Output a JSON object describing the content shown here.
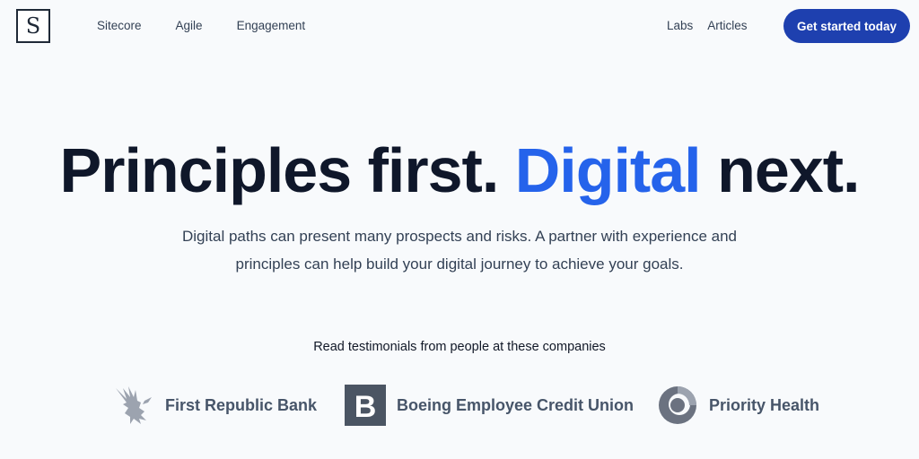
{
  "header": {
    "logo_letter": "S",
    "nav_left": [
      "Sitecore",
      "Agile",
      "Engagement"
    ],
    "nav_right": [
      "Labs",
      "Articles"
    ],
    "cta_label": "Get started today"
  },
  "hero": {
    "title_part1": "Principles first. ",
    "title_accent": "Digital",
    "title_part2": " next.",
    "subtitle": "Digital paths can present many prospects and risks. A partner with experience and principles can help build your digital journey to achieve your goals."
  },
  "testimonials": {
    "heading": "Read testimonials from people at these companies",
    "companies": [
      {
        "name": "First Republic Bank",
        "icon": "eagle-icon"
      },
      {
        "name": "Boeing Employee Credit Union",
        "icon": "b-logo-icon"
      },
      {
        "name": "Priority Health",
        "icon": "swirl-icon"
      }
    ]
  },
  "colors": {
    "background": "#f8fafc",
    "accent": "#2563eb",
    "cta": "#1e40af",
    "text": "#0f172a"
  }
}
